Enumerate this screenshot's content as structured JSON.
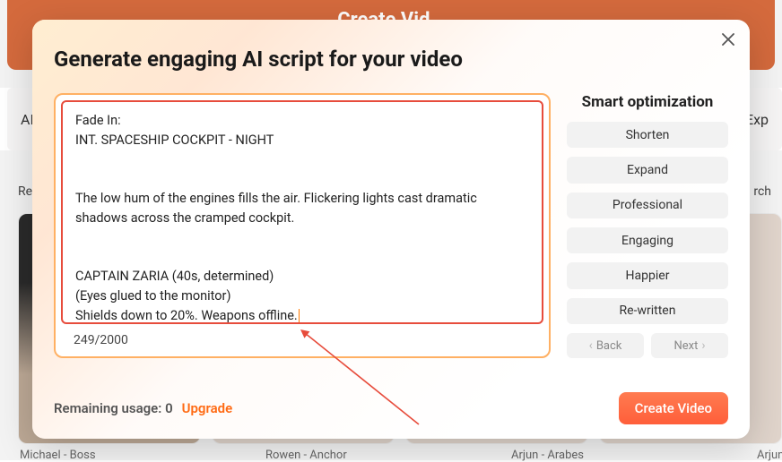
{
  "background": {
    "banner_text": "Create Vid…",
    "chips": [
      "AI",
      "Exp"
    ],
    "content_left": "Re",
    "content_right": "rch",
    "captions": [
      "Michael - Boss",
      "Rowen - Anchor",
      "Arjun - Arabes",
      "Arjun"
    ]
  },
  "modal": {
    "title": "Generate engaging AI script for your video",
    "script_text": "Fade In:\nINT. SPACESHIP COCKPIT - NIGHT\n\nThe low hum of the engines fills the air. Flickering lights cast dramatic shadows across the cramped cockpit.\n\nCAPTAIN ZARIA (40s, determined)\n(Eyes glued to the monitor)\nShields down to 20%. Weapons offline.",
    "counter": "249/2000",
    "smart_optimization": {
      "title": "Smart optimization",
      "options": [
        "Shorten",
        "Expand",
        "Professional",
        "Engaging",
        "Happier",
        "Re-written"
      ],
      "back": "Back",
      "next": "Next"
    },
    "footer": {
      "remaining_label": "Remaining usage: ",
      "remaining_count": "0",
      "upgrade": "Upgrade",
      "create": "Create Video"
    }
  }
}
